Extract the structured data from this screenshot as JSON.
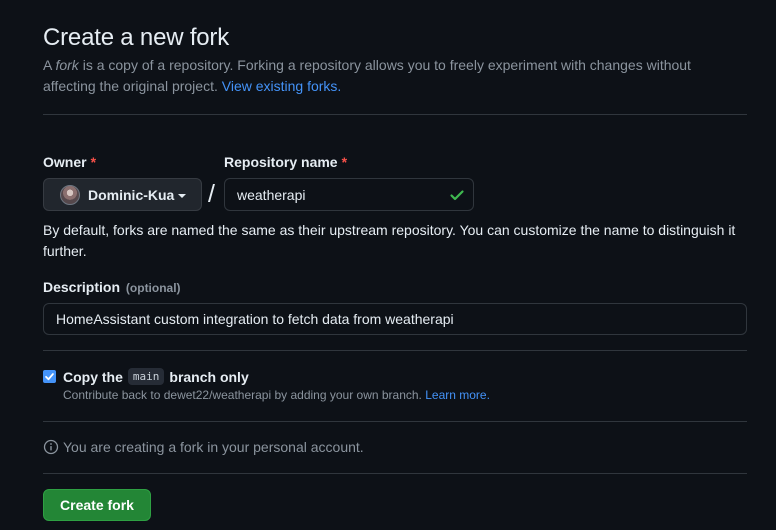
{
  "header": {
    "title": "Create a new fork",
    "intro_prefix": "A ",
    "intro_fork_word": "fork",
    "intro_text": " is a copy of a repository. Forking a repository allows you to freely experiment with changes without affecting the original project. ",
    "view_forks_link": "View existing forks."
  },
  "owner": {
    "label": "Owner",
    "required_mark": "*",
    "selected": "Dominic-Kua"
  },
  "separator": "/",
  "repository": {
    "label": "Repository name",
    "required_mark": "*",
    "value": "weatherapi",
    "valid": true,
    "helper": "By default, forks are named the same as their upstream repository. You can customize the name to distinguish it further."
  },
  "description": {
    "label": "Description",
    "optional_label": "(optional)",
    "value": "HomeAssistant custom integration to fetch data from weatherapi"
  },
  "copy_branch": {
    "checked": true,
    "label_prefix": "Copy the",
    "branch": "main",
    "label_suffix": "branch only",
    "note": "Contribute back to dewet22/weatherapi by adding your own branch. ",
    "learn_more": "Learn more."
  },
  "info": {
    "text": "You are creating a fork in your personal account."
  },
  "actions": {
    "create_label": "Create fork"
  },
  "colors": {
    "background": "#0d1117",
    "link": "#4493f8",
    "primary_button": "#238636",
    "required": "#f85149",
    "valid_check": "#3fb950"
  }
}
